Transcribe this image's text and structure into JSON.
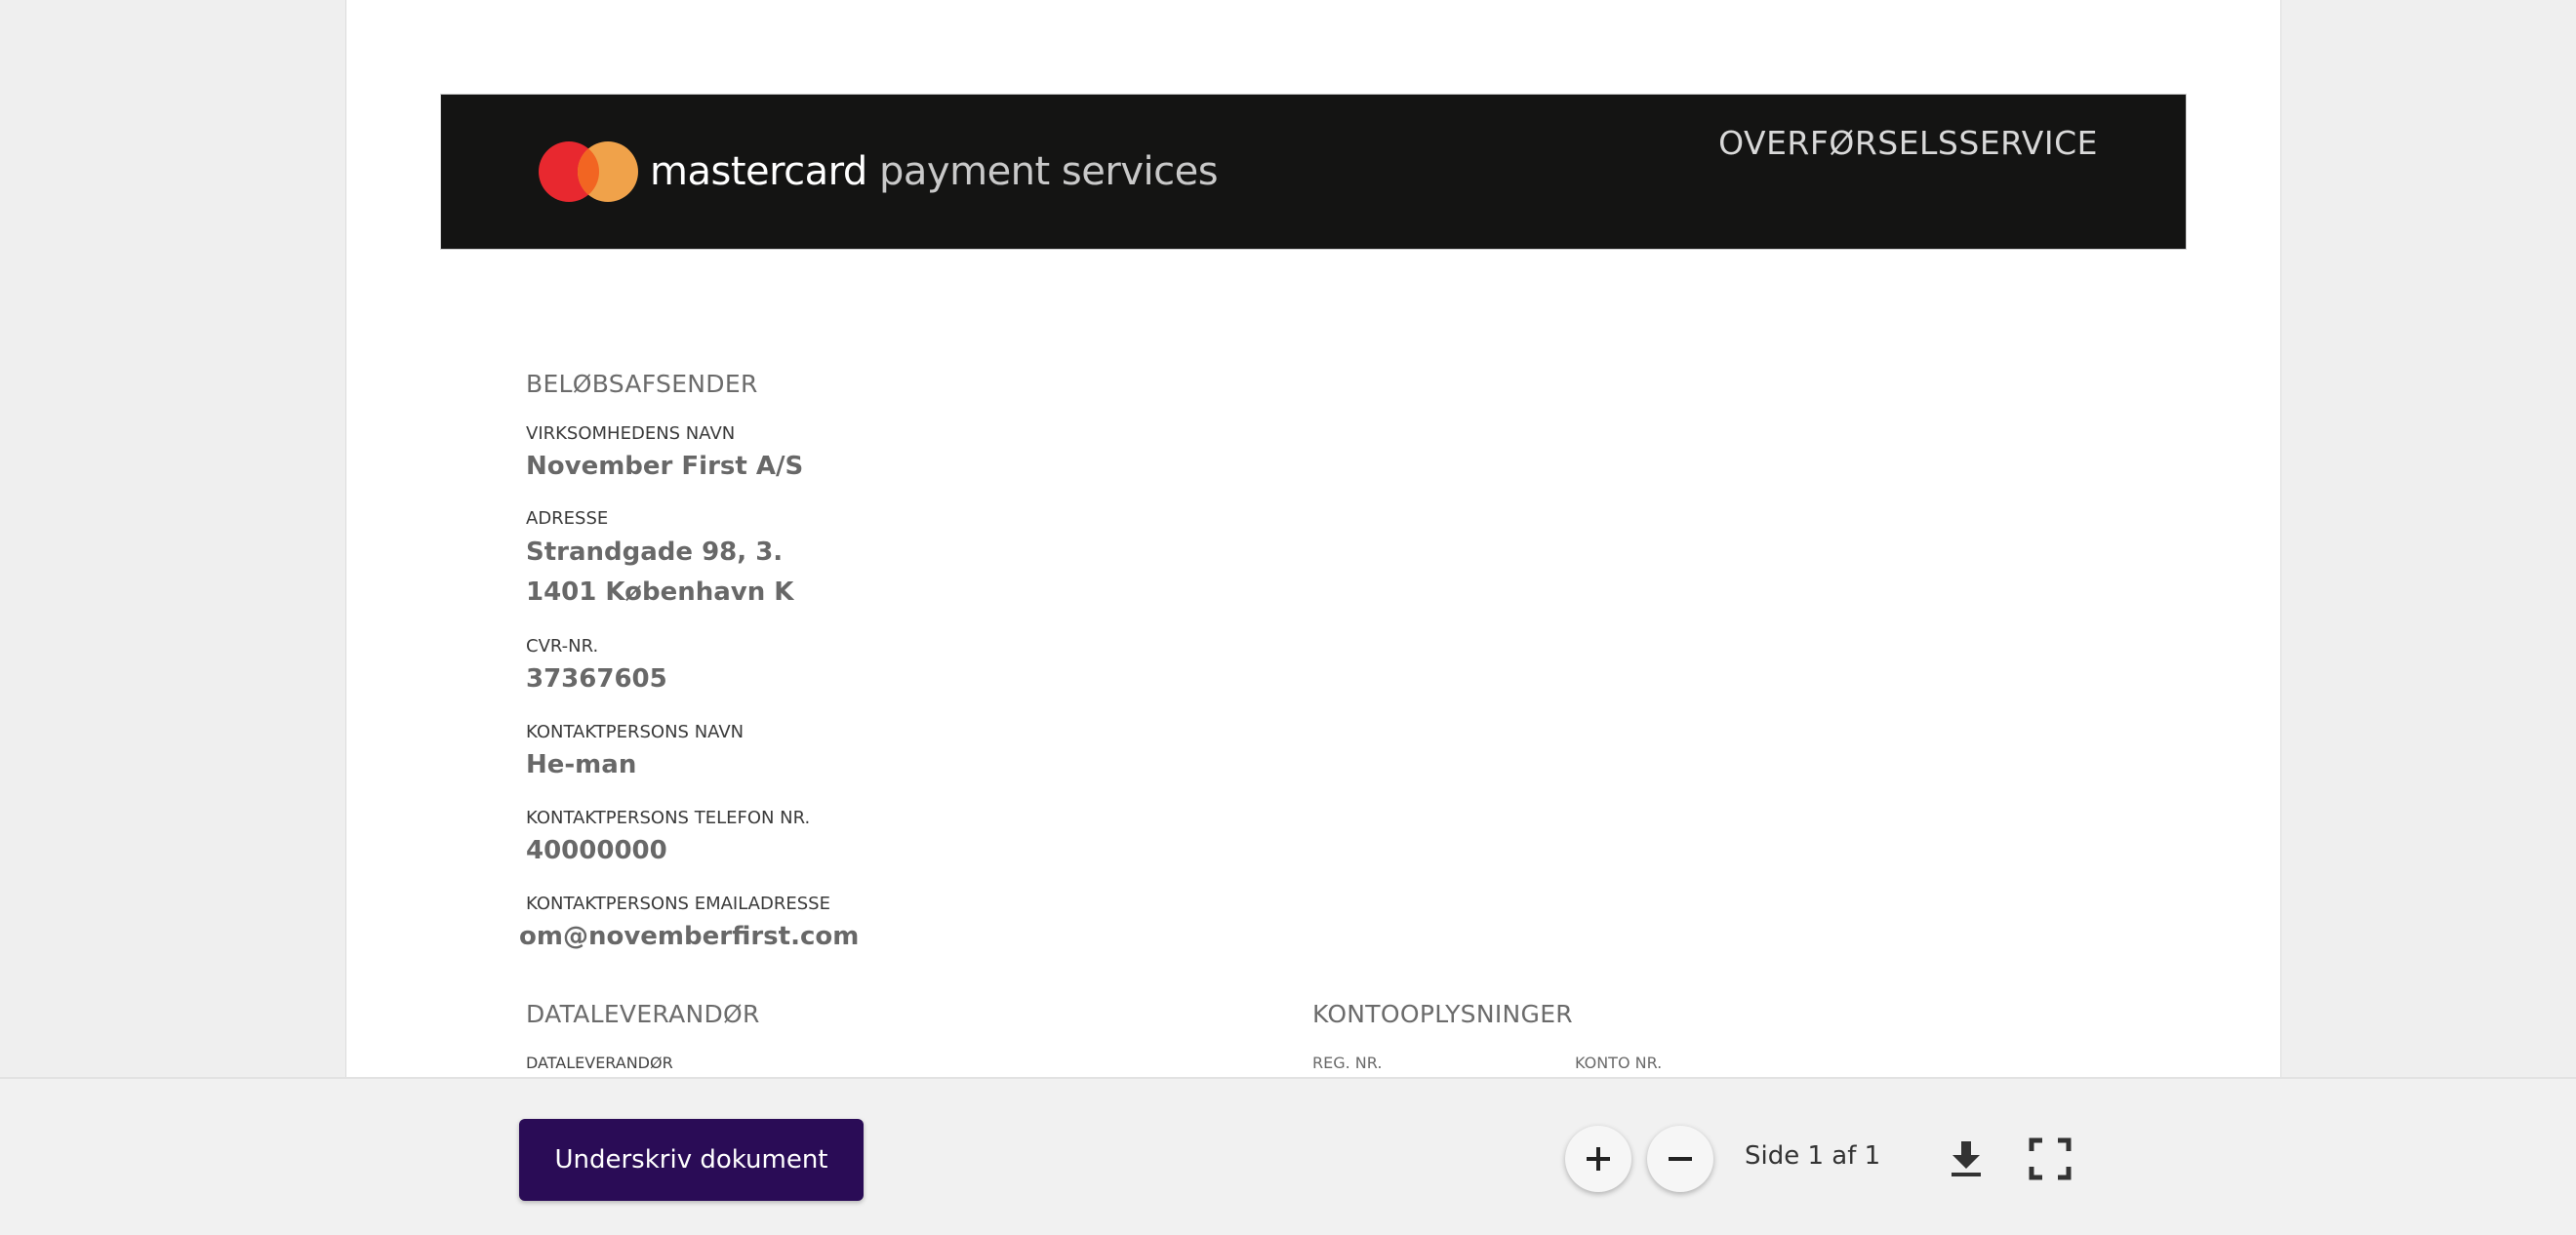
{
  "header": {
    "brand_name": "mastercard",
    "brand_suffix": "payment services",
    "service_title": "OVERFØRSELSSERVICE",
    "logo_colors": {
      "red": "#e8282f",
      "orange": "#f0a24a"
    }
  },
  "sender": {
    "section_title": "BELØBSAFSENDER",
    "company_label": "VIRKSOMHEDENS NAVN",
    "company_value": "November First A/S",
    "address_label": "ADRESSE",
    "address_line1": "Strandgade 98, 3.",
    "address_line2": "1401 København K",
    "cvr_label": "CVR-NR.",
    "cvr_value": "37367605",
    "contact_name_label": "KONTAKTPERSONS NAVN",
    "contact_name_value": "He-man",
    "contact_phone_label": "KONTAKTPERSONS TELEFON NR.",
    "contact_phone_value": "40000000",
    "contact_email_label": "KONTAKTPERSONS EMAILADRESSE",
    "contact_email_value": "om@novemberfirst.com"
  },
  "data_provider": {
    "section_title": "DATALEVERANDØR",
    "field_label": "DATALEVERANDØR"
  },
  "account": {
    "section_title": "KONTOOPLYSNINGER",
    "reg_label": "REG. NR.",
    "konto_label": "KONTO NR."
  },
  "toolbar": {
    "sign_button": "Underskriv dokument",
    "page_indicator": "Side 1 af 1",
    "accent_color": "#2a0c56"
  },
  "icons": [
    "zoom-in-icon",
    "zoom-out-icon",
    "download-icon",
    "fullscreen-icon"
  ]
}
